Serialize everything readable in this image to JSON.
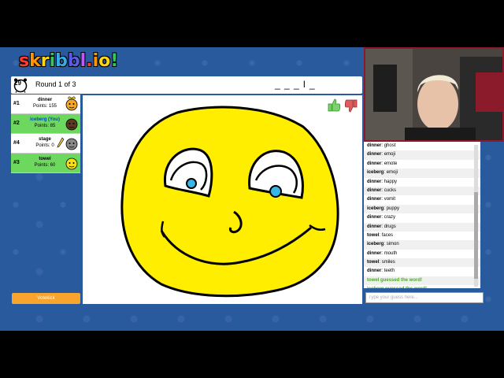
{
  "logo": {
    "letters": [
      "s",
      "k",
      "r",
      "i",
      "b",
      "b",
      "l",
      ".",
      "i",
      "o",
      "!"
    ],
    "colors": [
      "#ff3b30",
      "#ff9500",
      "#ffd60a",
      "#34c759",
      "#32ade6",
      "#5e5ce6",
      "#bf5af2",
      "#ff3b30",
      "#ff9500",
      "#ffd60a",
      "#34c759"
    ]
  },
  "topbar": {
    "timer": "29",
    "round": "Round 1 of 3",
    "word_hint": "_ _ _ l _"
  },
  "players": [
    {
      "rank": "#1",
      "name": "dinner",
      "points": "Points: 155",
      "you": false,
      "style": "light",
      "avatar_color": "#f5a623",
      "crown": true
    },
    {
      "rank": "#2",
      "name": "iceberg (You)",
      "points": "Points: 85",
      "you": true,
      "style": "guessed",
      "avatar_color": "#5a3b22",
      "crown": false
    },
    {
      "rank": "#4",
      "name": "stage",
      "points": "Points: 0",
      "you": false,
      "style": "light",
      "avatar_color": "#888888",
      "crown": false,
      "drawing": true
    },
    {
      "rank": "#3",
      "name": "towel",
      "points": "Points: 60",
      "you": false,
      "style": "guessed",
      "avatar_color": "#f7e01a",
      "crown": false
    }
  ],
  "votekick_label": "Votekick",
  "chat": {
    "messages": [
      {
        "user": "dinner",
        "text": "ghost"
      },
      {
        "user": "dinner",
        "text": "emoji"
      },
      {
        "user": "dinner",
        "text": "emote"
      },
      {
        "user": "iceberg",
        "text": "emoji"
      },
      {
        "user": "dinner",
        "text": "happy"
      },
      {
        "user": "dinner",
        "text": "cucks"
      },
      {
        "user": "dinner",
        "text": "vomit"
      },
      {
        "user": "iceberg",
        "text": "puppy"
      },
      {
        "user": "dinner",
        "text": "crazy"
      },
      {
        "user": "dinner",
        "text": "drugs"
      },
      {
        "user": "towel",
        "text": "faces"
      },
      {
        "user": "iceberg",
        "text": "simon"
      },
      {
        "user": "dinner",
        "text": "mouth"
      },
      {
        "user": "towel",
        "text": "smiles"
      },
      {
        "user": "dinner",
        "text": "teeth"
      }
    ],
    "system": [
      "towel guessed the word!",
      "iceberg guessed the word!"
    ],
    "placeholder": "Type your guess here..."
  },
  "colors": {
    "background": "#2a5a9e",
    "face_fill": "#ffee00",
    "iris": "#38b6e8",
    "guessed_green": "#6cd95e",
    "accent_orange": "#f9a42d"
  }
}
